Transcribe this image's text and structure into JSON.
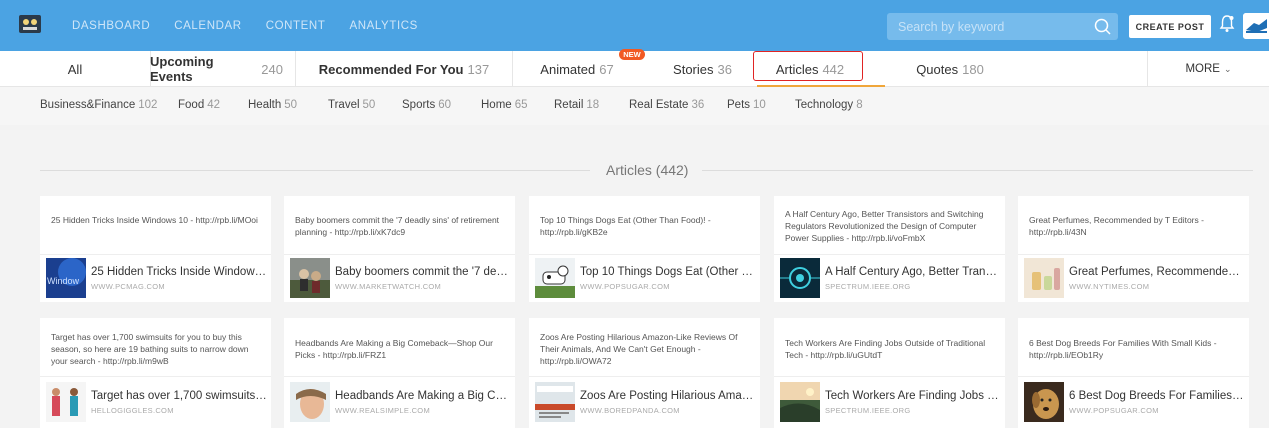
{
  "nav": {
    "links": [
      "DASHBOARD",
      "CALENDAR",
      "CONTENT",
      "ANALYTICS"
    ],
    "search_placeholder": "Search by keyword",
    "create_post": "CREATE POST",
    "accent": "#4ba3e3"
  },
  "tabs": {
    "all": "All",
    "upcoming_label": "Upcoming Events",
    "upcoming_count": "240",
    "recommended_label": "Recommended For You",
    "recommended_count": "137",
    "animated_label": "Animated",
    "animated_count": "67",
    "new_badge": "NEW",
    "stories_label": "Stories",
    "stories_count": "36",
    "articles_label": "Articles",
    "articles_count": "442",
    "quotes_label": "Quotes",
    "quotes_count": "180",
    "more": "MORE"
  },
  "categories": [
    {
      "label": "Business&Finance",
      "count": "102"
    },
    {
      "label": "Food",
      "count": "42"
    },
    {
      "label": "Health",
      "count": "50"
    },
    {
      "label": "Travel",
      "count": "50"
    },
    {
      "label": "Sports",
      "count": "60"
    },
    {
      "label": "Home",
      "count": "65"
    },
    {
      "label": "Retail",
      "count": "18"
    },
    {
      "label": "Real Estate",
      "count": "36"
    },
    {
      "label": "Pets",
      "count": "10"
    },
    {
      "label": "Technology",
      "count": "8"
    }
  ],
  "section_title": "Articles (442)",
  "cards": [
    {
      "text": "25 Hidden Tricks Inside Windows 10 - http://rpb.li/MOoi",
      "title": "25 Hidden Tricks Inside Windows 10 ...",
      "source": "WWW.PCMAG.COM",
      "thumb_text": "Window"
    },
    {
      "text": "Baby boomers commit the '7 deadly sins' of retirement planning - http://rpb.li/xK7dc9",
      "title": "Baby boomers commit the '7 deadly s...",
      "source": "WWW.MARKETWATCH.COM"
    },
    {
      "text": "Top 10 Things Dogs Eat (Other Than Food)! - http://rpb.li/gKB2e",
      "title": "Top 10 Things Dogs Eat (Other Than ...",
      "source": "WWW.POPSUGAR.COM"
    },
    {
      "text": "A Half Century Ago, Better Transistors and Switching Regulators Revolutionized the Design of Computer Power Supplies - http://rpb.li/voFmbX",
      "title": "A Half Century Ago, Better Transistor...",
      "source": "SPECTRUM.IEEE.ORG"
    },
    {
      "text": "Great Perfumes, Recommended by T Editors - http://rpb.li/43N",
      "title": "Great Perfumes, Recommended by T ...",
      "source": "WWW.NYTIMES.COM"
    },
    {
      "text": "Target has over 1,700 swimsuits for you to buy this season, so here are 19 bathing suits to narrow down your search - http://rpb.li/m9wB",
      "title": "Target has over 1,700 swimsuits for y...",
      "source": "HELLOGIGGLES.COM"
    },
    {
      "text": "Headbands Are Making a Big Comeback—Shop Our Picks - http://rpb.li/FRZ1",
      "title": "Headbands Are Making a Big Comeb...",
      "source": "WWW.REALSIMPLE.COM"
    },
    {
      "text": "Zoos Are Posting Hilarious Amazon-Like Reviews Of Their Animals, And We Can't Get Enough - http://rpb.li/OWA72",
      "title": "Zoos Are Posting Hilarious Amazon-L...",
      "source": "WWW.BOREDPANDA.COM"
    },
    {
      "text": "Tech Workers Are Finding Jobs Outside of Traditional Tech - http://rpb.li/uGUtdT",
      "title": "Tech Workers Are Finding Jobs Outsi...",
      "source": "SPECTRUM.IEEE.ORG"
    },
    {
      "text": "6 Best Dog Breeds For Families With Small Kids - http://rpb.li/EOb1Ry",
      "title": "6 Best Dog Breeds For Families With ...",
      "source": "WWW.POPSUGAR.COM"
    }
  ]
}
